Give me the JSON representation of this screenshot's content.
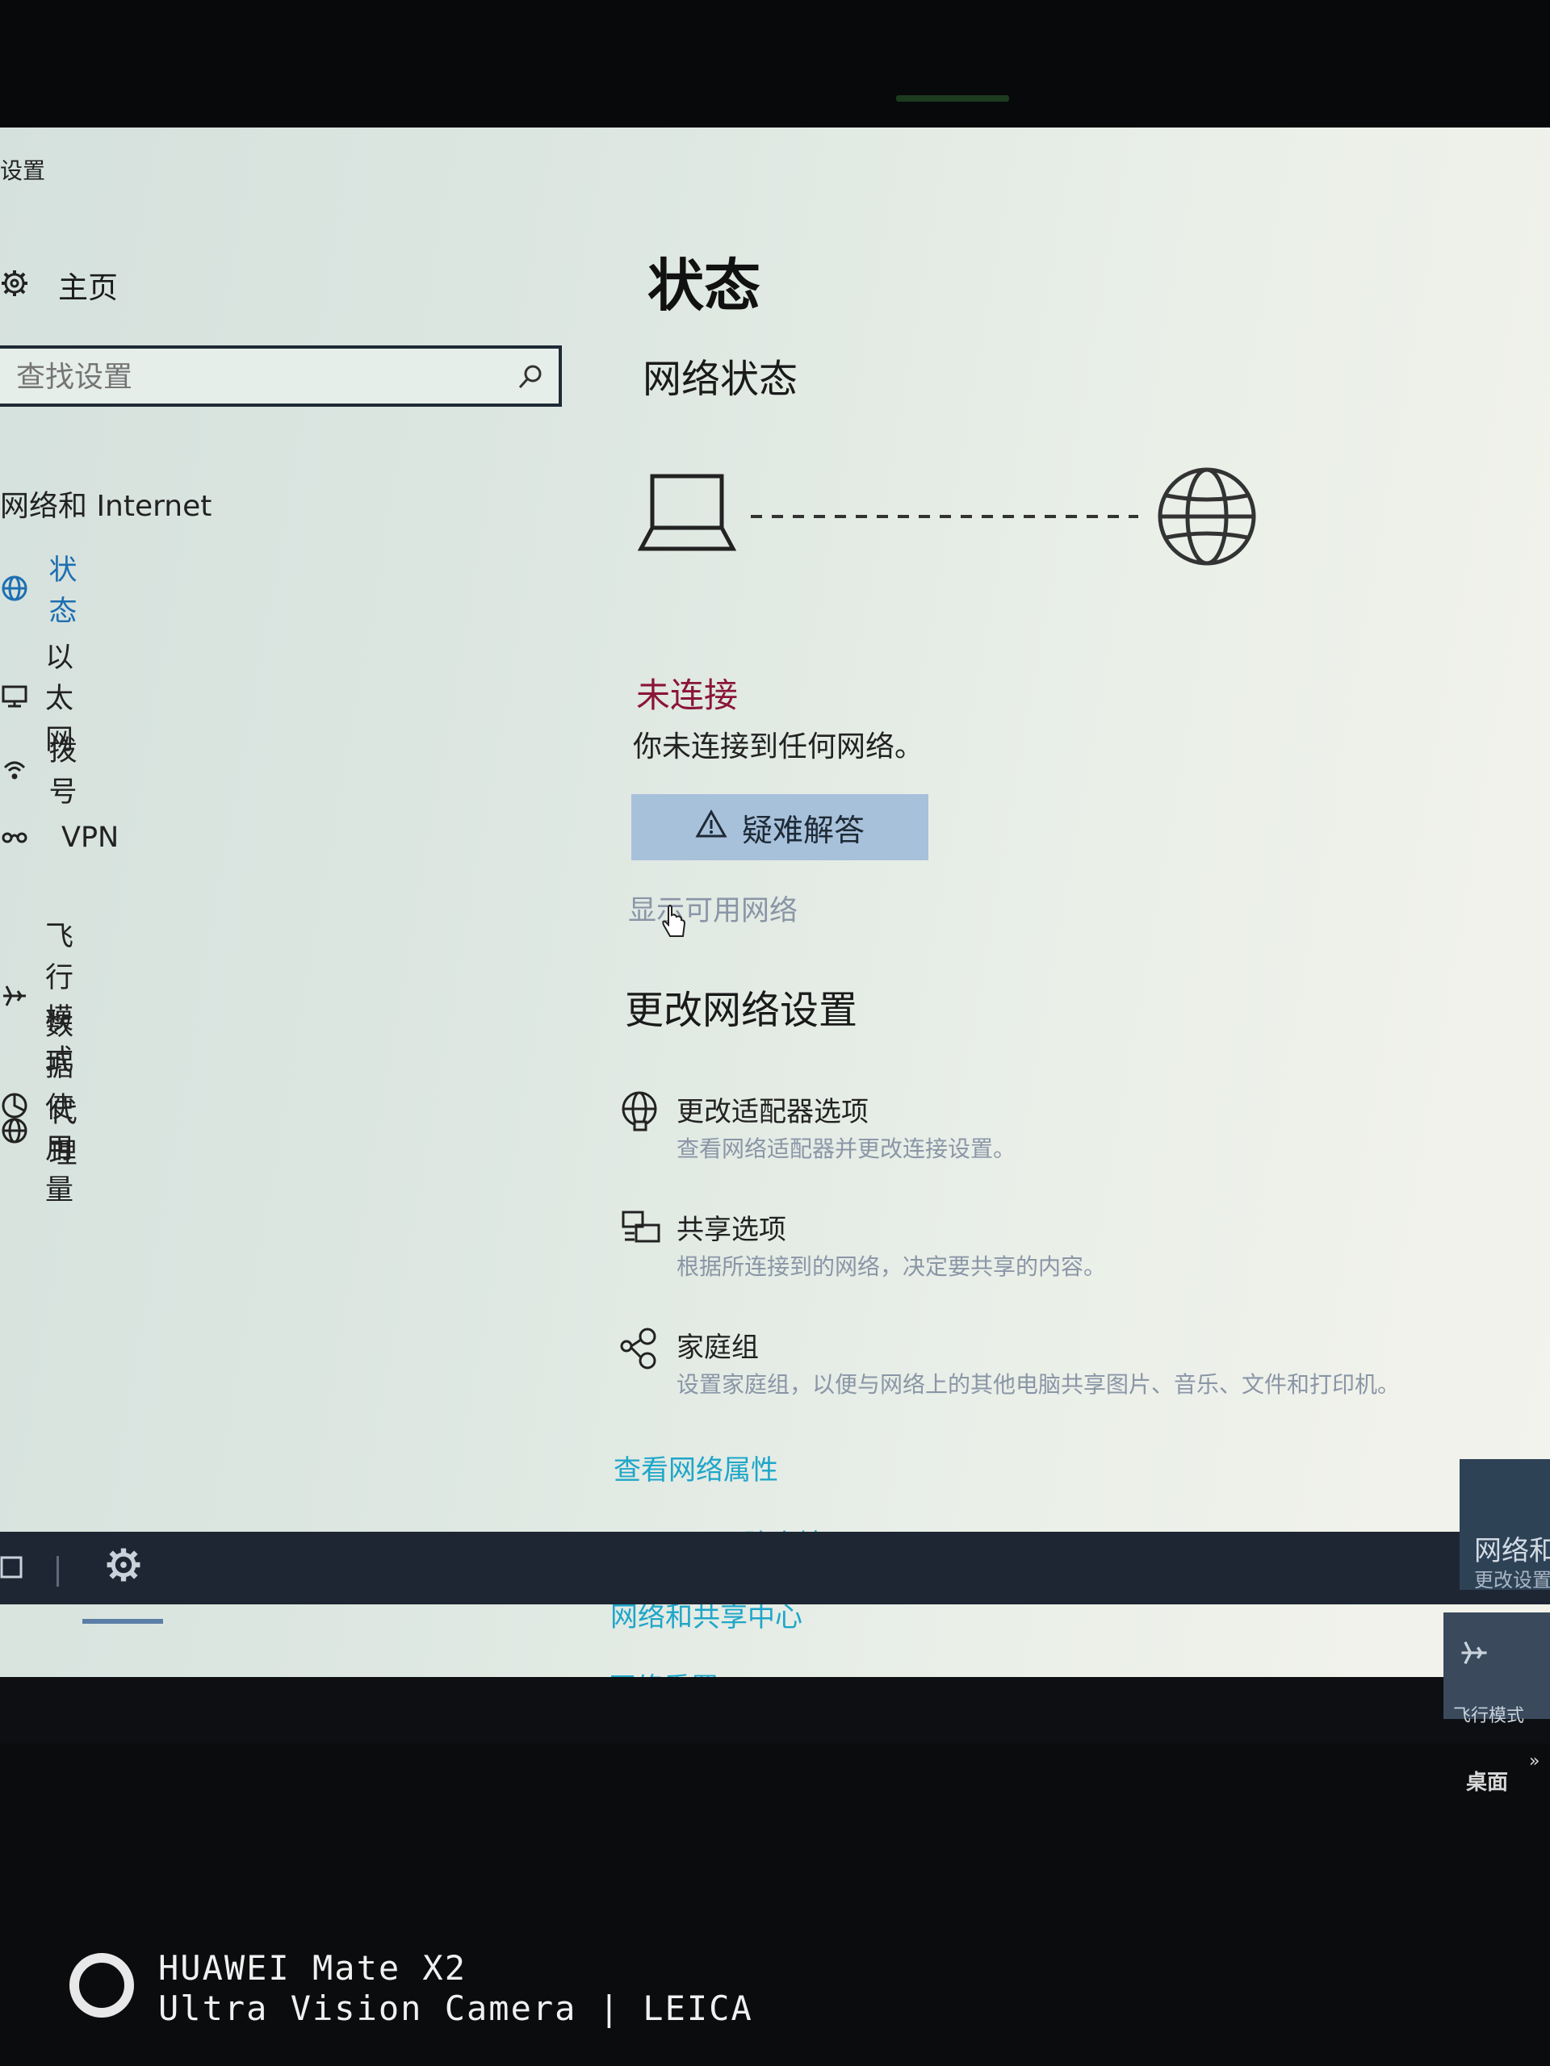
{
  "window": {
    "title": "设置"
  },
  "sidebar": {
    "home_label": "主页",
    "search_placeholder": "查找设置",
    "section_title": "网络和 Internet",
    "items": [
      {
        "label": "状态",
        "icon": "globe-icon",
        "active": true
      },
      {
        "label": "以太网",
        "icon": "ethernet-icon"
      },
      {
        "label": "拨号",
        "icon": "dialup-icon"
      },
      {
        "label": "VPN",
        "icon": "vpn-icon"
      },
      {
        "label": "飞行模式",
        "icon": "airplane-icon"
      },
      {
        "label": "数据使用量",
        "icon": "data-usage-icon"
      },
      {
        "label": "代理",
        "icon": "globe-icon"
      }
    ]
  },
  "main": {
    "title": "状态",
    "network_status_title": "网络状态",
    "status": "未连接",
    "status_detail": "你未连接到任何网络。",
    "troubleshoot_label": "疑难解答",
    "show_networks_link": "显示可用网络",
    "change_settings_title": "更改网络设置",
    "options": [
      {
        "title": "更改适配器选项",
        "desc": "查看网络适配器并更改连接设置。",
        "icon": "adapter-icon"
      },
      {
        "title": "共享选项",
        "desc": "根据所连接到的网络，决定要共享的内容。",
        "icon": "sharing-icon"
      },
      {
        "title": "家庭组",
        "desc": "设置家庭组，以便与网络上的其他电脑共享图片、音乐、文件和打印机。",
        "icon": "homegroup-icon"
      }
    ],
    "links": [
      "查看网络属性",
      "Windows 防火墙",
      "网络和共享中心",
      "网络重置"
    ]
  },
  "notification": {
    "title": "网络和",
    "desc": "更改设置"
  },
  "quick_action": {
    "label": "飞行模式"
  },
  "taskbar": {
    "desktop_label": "桌面",
    "desktop_arrow": "»"
  },
  "watermark": {
    "line1": "HUAWEI Mate X2",
    "line2": "Ultra Vision Camera | LEICA"
  },
  "colors": {
    "status_red": "#8a1538",
    "link_blue": "#1fa6c9",
    "accent": "#1e6fb0",
    "button_bg": "#a8c1db"
  }
}
